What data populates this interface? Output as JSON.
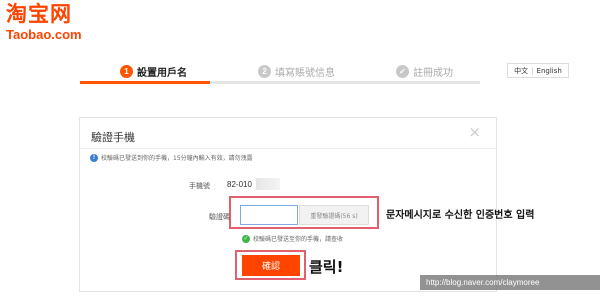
{
  "logo": {
    "text_cn": "淘宝网",
    "text_en": "Taobao.com"
  },
  "steps": [
    {
      "num": "1",
      "label": "設置用戶名",
      "state": "active"
    },
    {
      "num": "2",
      "label": "填寫賬號信息",
      "state": "inactive"
    },
    {
      "num": "✓",
      "label": "註冊成功",
      "state": "inactive"
    }
  ],
  "lang": {
    "option1": "中文",
    "separator": "|",
    "option2": "English"
  },
  "dialog": {
    "title": "驗證手機",
    "close_glyph": "×",
    "info_text": "校驗碼已發送到你的手機，15分鐘內輸入有效，請勿洩露",
    "phone_label": "手機號",
    "phone_value": "82-010",
    "code_label": "驗證碼",
    "code_value": "",
    "resend_label": "重發驗證碼(56 s)",
    "sent_notice": "校驗碼已發送至你的手機，請查收",
    "confirm_label": "確認"
  },
  "annotations": {
    "sms_note": "문자메시지로 수신한 인증번호 입력",
    "click_note": "클릭!"
  },
  "watermark": "http://blog.naver.com/claymoree",
  "colors": {
    "brand": "#ff4400",
    "highlight": "#e06070",
    "info": "#3a80d2",
    "success": "#3db54a"
  }
}
